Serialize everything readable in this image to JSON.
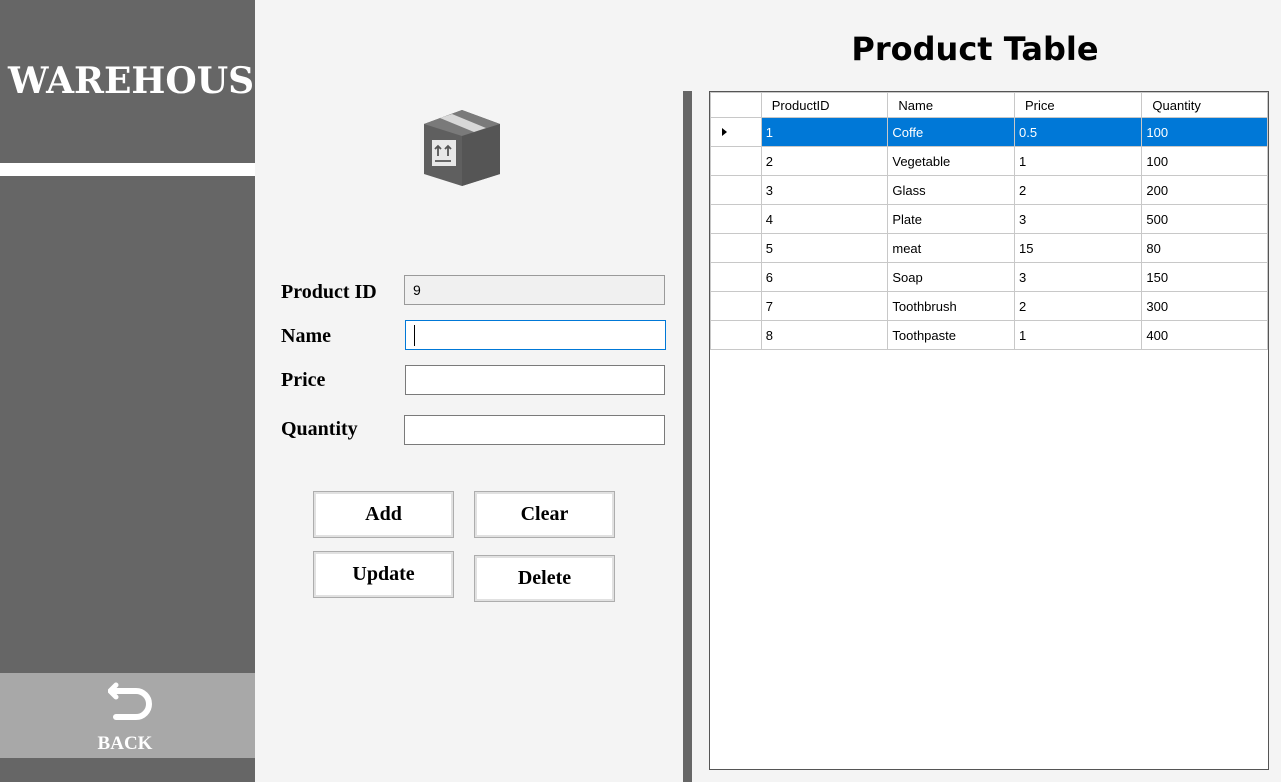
{
  "sidebar": {
    "brand": "WAREHOUSE",
    "back_label": "BACK"
  },
  "form": {
    "product_id_label": "Product ID",
    "product_id_value": "9",
    "name_label": "Name",
    "name_value": "",
    "price_label": "Price",
    "price_value": "",
    "quantity_label": "Quantity",
    "quantity_value": ""
  },
  "buttons": {
    "add": "Add",
    "clear": "Clear",
    "update": "Update",
    "delete": "Delete"
  },
  "table": {
    "title": "Product Table",
    "columns": [
      "ProductID",
      "Name",
      "Price",
      "Quantity"
    ],
    "rows": [
      [
        "1",
        "Coffe",
        "0.5",
        "100"
      ],
      [
        "2",
        "Vegetable",
        "1",
        "100"
      ],
      [
        "3",
        "Glass",
        "2",
        "200"
      ],
      [
        "4",
        "Plate",
        "3",
        "500"
      ],
      [
        "5",
        "meat",
        "15",
        "80"
      ],
      [
        "6",
        "Soap",
        "3",
        "150"
      ],
      [
        "7",
        "Toothbrush",
        "2",
        "300"
      ],
      [
        "8",
        "Toothpaste",
        "1",
        "400"
      ]
    ],
    "selected_row": 0
  },
  "icons": {
    "product": "box-icon",
    "back": "undo-arrow-icon"
  },
  "colors": {
    "sidebar": "#666666",
    "selection": "#0078d7",
    "back_button": "#a8a8a8"
  }
}
